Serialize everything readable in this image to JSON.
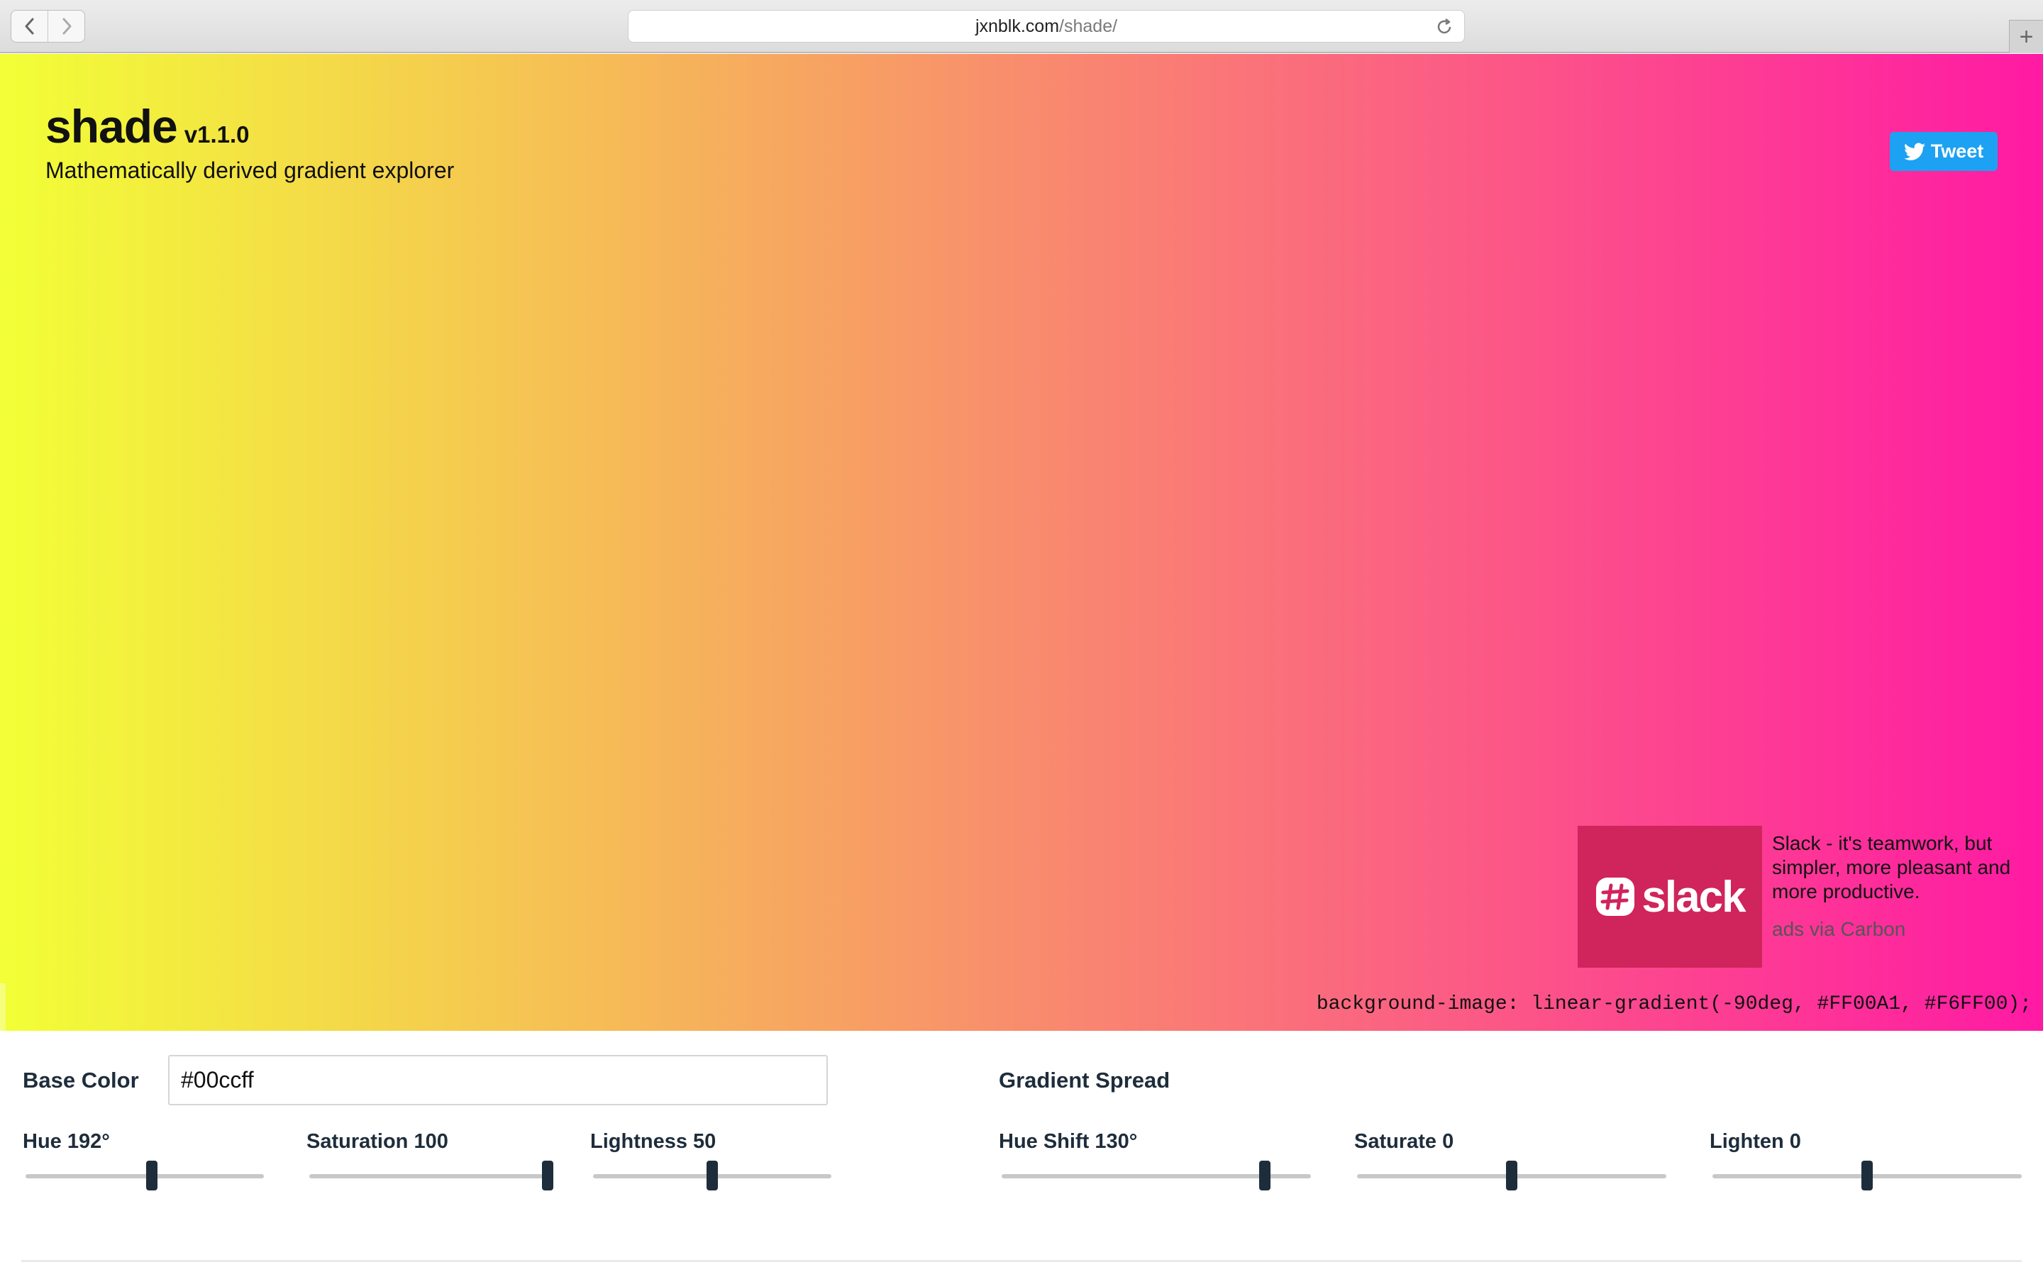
{
  "browser": {
    "url_domain": "jxnblk.com",
    "url_path": "/shade/",
    "new_tab_label": "+"
  },
  "hero": {
    "title": "shade",
    "version": "v1.1.0",
    "subtitle": "Mathematically derived gradient explorer",
    "tweet_label": "Tweet",
    "gradient_start": "#FF1AA4",
    "gradient_end": "#F2FF36",
    "css_output": "background-image: linear-gradient(-90deg, #FF00A1, #F6FF00);"
  },
  "ad": {
    "logo_word": "slack",
    "logo_color": "#d0245c",
    "text": "Slack - it's teamwork, but simpler, more pleasant and more productive.",
    "via": "ads via Carbon"
  },
  "controls": {
    "base_color_label": "Base Color",
    "base_color_value": "#00ccff",
    "gradient_spread_label": "Gradient Spread",
    "sliders": [
      {
        "label": "Hue 192°",
        "fraction": 0.53
      },
      {
        "label": "Saturation 100",
        "fraction": 1.0
      },
      {
        "label": "Lightness 50",
        "fraction": 0.5
      },
      {
        "label": "Hue Shift 130°",
        "fraction": 0.85
      },
      {
        "label": "Saturate 0",
        "fraction": 0.5
      },
      {
        "label": "Lighten 0",
        "fraction": 0.5
      }
    ],
    "accent": "#1e2d3b"
  }
}
